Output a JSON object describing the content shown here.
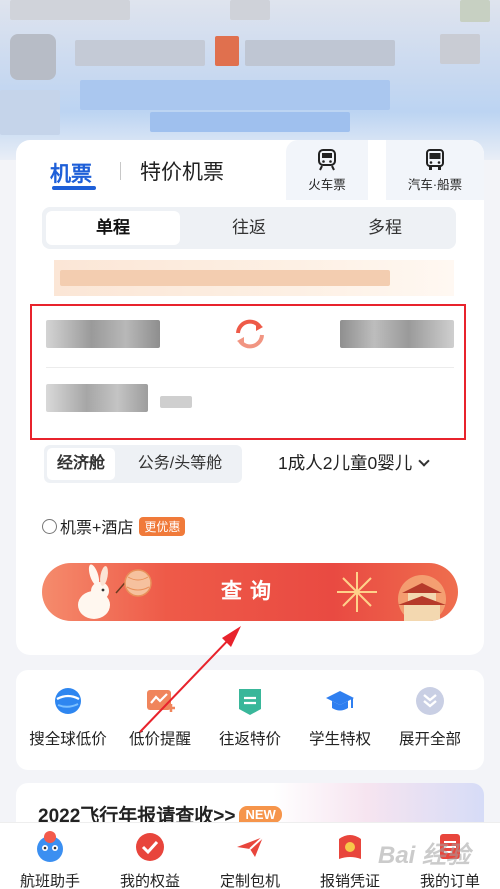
{
  "tabs": {
    "flight": "机票",
    "special_flight": "特价机票"
  },
  "modes": [
    {
      "label": "火车票",
      "icon": "train-icon"
    },
    {
      "label": "汽车·船票",
      "icon": "bus-icon"
    }
  ],
  "trip_types": [
    {
      "label": "单程",
      "active": true
    },
    {
      "label": "往返",
      "active": false
    },
    {
      "label": "多程",
      "active": false
    }
  ],
  "cabin": {
    "economy": "经济舱",
    "business": "公务/头等舱"
  },
  "passengers": "1成人2儿童0婴儿",
  "combo": {
    "label": "机票+酒店",
    "badge": "更优惠"
  },
  "search_label": "查询",
  "quick_links": [
    {
      "label": "搜全球低价",
      "icon": "globe-icon"
    },
    {
      "label": "低价提醒",
      "icon": "price-alert-icon"
    },
    {
      "label": "往返特价",
      "icon": "round-trip-icon"
    },
    {
      "label": "学生特权",
      "icon": "graduation-cap-icon"
    },
    {
      "label": "展开全部",
      "icon": "chevron-double-down-icon"
    }
  ],
  "report": {
    "title": "2022飞行年报请查收>>",
    "badge": "NEW"
  },
  "bottom_nav": [
    {
      "label": "航班助手",
      "icon": "flight-assistant-icon"
    },
    {
      "label": "我的权益",
      "icon": "benefits-icon"
    },
    {
      "label": "定制包机",
      "icon": "charter-icon"
    },
    {
      "label": "报销凭证",
      "icon": "receipt-icon"
    },
    {
      "label": "我的订单",
      "icon": "orders-icon"
    }
  ],
  "watermark": "Bai 经验",
  "colors": {
    "accent": "#1e5fd8",
    "highlight": "#e8232c",
    "search_button": "#e94a42",
    "badge": "#f07a3a"
  }
}
